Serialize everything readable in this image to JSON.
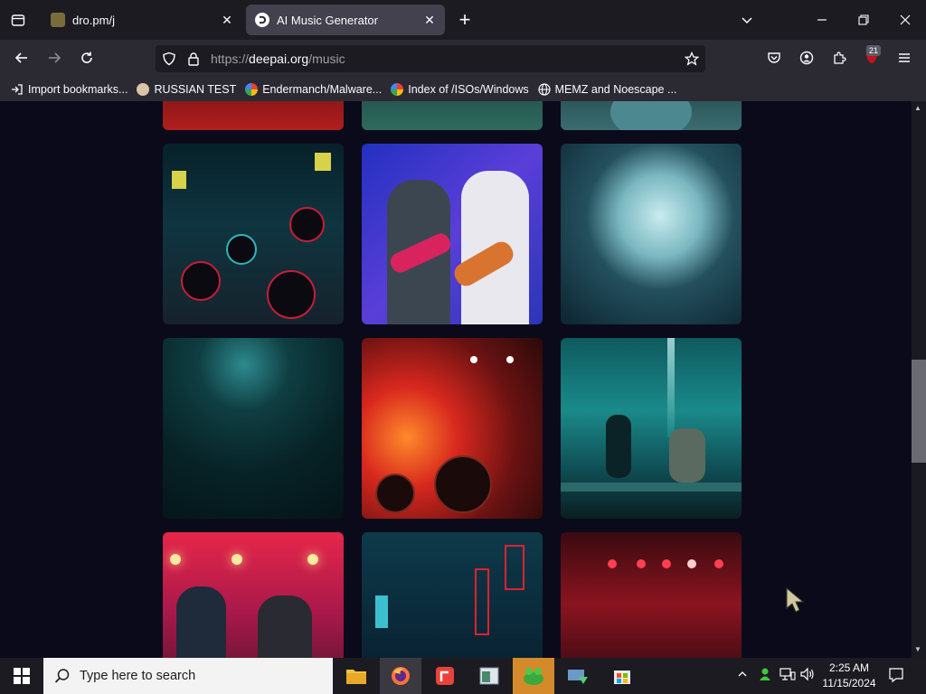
{
  "tabs": [
    {
      "title": "dro.pm/j",
      "active": false
    },
    {
      "title": "AI Music Generator",
      "active": true
    }
  ],
  "url": {
    "prefix": "https://",
    "domain": "deepai.org",
    "path": "/music"
  },
  "extension_badge": "21",
  "bookmarks": [
    {
      "label": "Import bookmarks...",
      "icon": "import-icon"
    },
    {
      "label": "RUSSIAN TEST",
      "icon": "github-icon"
    },
    {
      "label": "Endermanch/Malware...",
      "icon": "google-icon"
    },
    {
      "label": "Index of /ISOs/Windows",
      "icon": "google-icon"
    },
    {
      "label": "MEMZ and Noescape ...",
      "icon": "globe-icon"
    }
  ],
  "gallery": [
    {
      "subject": "cyberpunk speakers"
    },
    {
      "subject": "two guitarists on stage"
    },
    {
      "subject": "full moon over clouds"
    },
    {
      "subject": "misty forest"
    },
    {
      "subject": "rock concert with fire"
    },
    {
      "subject": "underwater performers"
    },
    {
      "subject": "two guitarists under red lights"
    },
    {
      "subject": "neon city street"
    },
    {
      "subject": "band on red-lit stage"
    }
  ],
  "taskbar": {
    "search_placeholder": "Type here to search",
    "time": "2:25 AM",
    "date": "11/15/2024"
  },
  "colors": {
    "accent": "#42414d",
    "content_bg": "#0b0a1a"
  }
}
